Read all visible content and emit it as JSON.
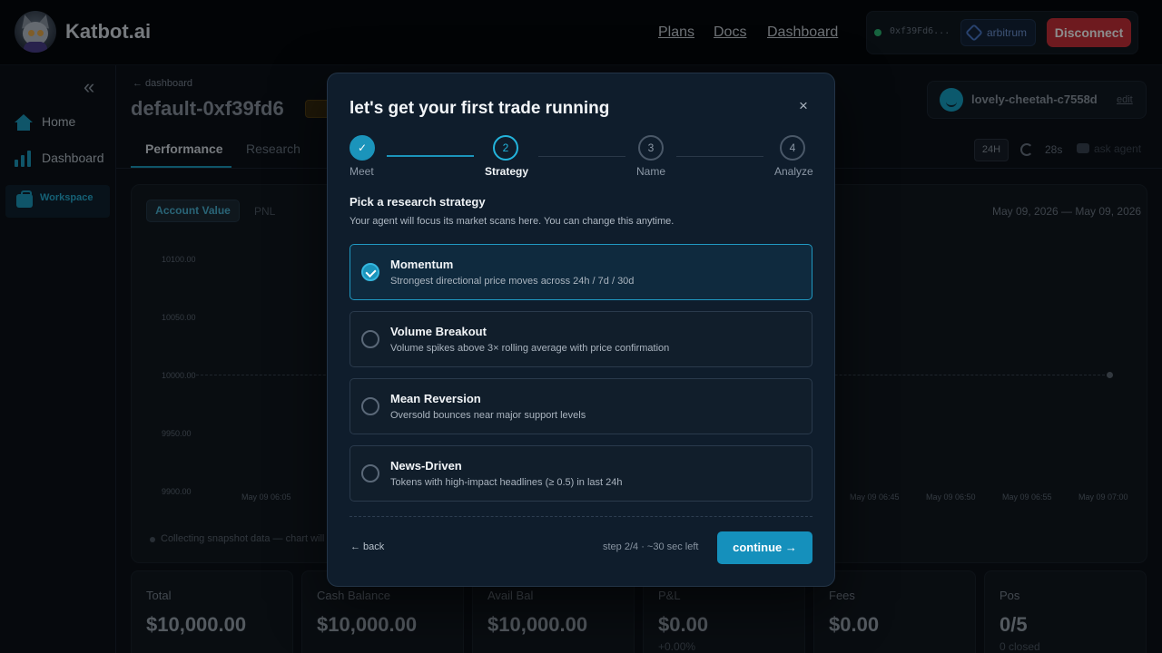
{
  "topbar": {
    "brand": "Katbot.ai",
    "nav": [
      "Plans",
      "Docs",
      "Dashboard"
    ],
    "wallet_address": "0xf39Fd6...",
    "chain": "arbitrum",
    "disconnect_label": "Disconnect"
  },
  "sidebar": {
    "items": [
      {
        "label": "Home",
        "icon": "home-icon"
      },
      {
        "label": "Dashboard",
        "icon": "bar-chart-icon"
      },
      {
        "label": "Workspace",
        "icon": "briefcase-icon"
      }
    ]
  },
  "main": {
    "breadcrumb": "← dashboard",
    "title": "default-0xf39fd6",
    "tabs": [
      "Performance",
      "Research"
    ],
    "agent_name": "lovely-cheetah-c7558d",
    "agent_edit": "edit",
    "range_label": "24H",
    "refresh_timer": "28s",
    "ask_agent": "ask agent"
  },
  "chart": {
    "toggles": [
      "Account Value",
      "PNL"
    ],
    "date_range": "May 09, 2026 — May 09, 2026",
    "collecting": "Collecting snapshot data — chart will"
  },
  "chart_data": {
    "type": "line",
    "yticks": [
      "10100.00",
      "10050.00",
      "10000.00",
      "9950.00",
      "9900.00"
    ],
    "xticks": [
      "May 09 06:05",
      "May 09 06:45",
      "May 09 06:50",
      "May 09 06:55",
      "May 09 07:00"
    ],
    "series": [
      {
        "values": [
          10000.0,
          10000.0
        ]
      }
    ],
    "ylim": [
      9900,
      10100
    ]
  },
  "stats": [
    {
      "label": "Total",
      "value": "$10,000.00",
      "sub": ""
    },
    {
      "label": "Cash Balance",
      "value": "$10,000.00",
      "sub": ""
    },
    {
      "label": "Avail Bal",
      "value": "$10,000.00",
      "sub": ""
    },
    {
      "label": "P&L",
      "value": "$0.00",
      "sub": "+0.00%"
    },
    {
      "label": "Fees",
      "value": "$0.00",
      "sub": ""
    },
    {
      "label": "Pos",
      "value": "0/5",
      "sub": "0 closed"
    }
  ],
  "modal": {
    "title": "let's get your first trade running",
    "close": "×",
    "steps": [
      {
        "num": "✓",
        "label": "Meet"
      },
      {
        "num": "2",
        "label": "Strategy"
      },
      {
        "num": "3",
        "label": "Name"
      },
      {
        "num": "4",
        "label": "Analyze"
      }
    ],
    "section_title": "Pick a research strategy",
    "section_sub": "Your agent will focus its market scans here. You can change this anytime.",
    "options": [
      {
        "name": "Momentum",
        "desc": "Strongest directional price moves across 24h / 7d / 30d"
      },
      {
        "name": "Volume Breakout",
        "desc": "Volume spikes above 3× rolling average with price confirmation"
      },
      {
        "name": "Mean Reversion",
        "desc": "Oversold bounces near major support levels"
      },
      {
        "name": "News-Driven",
        "desc": "Tokens with high-impact headlines (≥ 0.5) in last 24h"
      }
    ],
    "back": "← back",
    "step_text": "step 2/4 · ~30 sec left",
    "continue": "continue →"
  }
}
